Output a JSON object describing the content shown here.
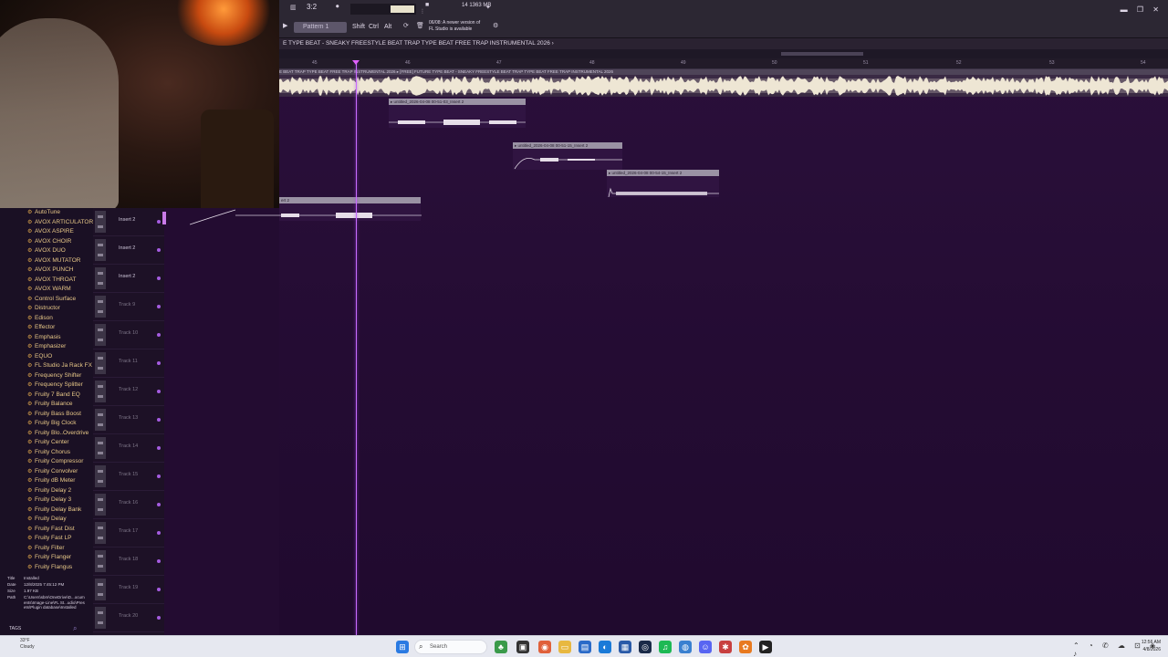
{
  "toolbar": {
    "tempo": "3:2",
    "cpu": "14   1363 MB",
    "pattern_label": "Pattern 1",
    "modifiers": [
      "Shift",
      "Ctrl",
      "Alt"
    ],
    "news_line1": "06/08: A newer version of",
    "news_line2": "FL Studio is available",
    "window_buttons": "▬ ❐ ✕"
  },
  "playlist": {
    "title": "E TYPE BEAT - SNEAKY FREESTYLE BEAT  TRAP TYPE BEAT  FREE TRAP INSTRUMENTAL 2026 ›",
    "ruler": [
      "45",
      "46",
      "47",
      "48",
      "49",
      "50",
      "51",
      "52",
      "53",
      "54"
    ],
    "main_clip_label": "E BEAT  TRAP TYPE BEAT  FREE TRAP INSTRUMENTAL 2026   ▸ [FREE] FUTURE TYPE BEAT - SNEAKY FREESTYLE BEAT  TRAP TYPE BEAT  FREE TRAP INSTRUMENTAL 2026",
    "clips": [
      {
        "label": "▸ untitled_2026-04-08 00-51-03_Insert 2"
      },
      {
        "label": "▸ untitled_2026-04-08 00-51-15_Insert 2"
      },
      {
        "label": "▸ untitled_2026-04-08 00-54-15_Insert 2"
      },
      {
        "label": "ert 2"
      }
    ]
  },
  "tracks": [
    {
      "name": "Insert 2",
      "active": true
    },
    {
      "name": "Insert 2",
      "active": true
    },
    {
      "name": "Insert 2",
      "active": true
    },
    {
      "name": "Track 9",
      "active": false
    },
    {
      "name": "Track 10",
      "active": false
    },
    {
      "name": "Track 11",
      "active": false
    },
    {
      "name": "Track 12",
      "active": false
    },
    {
      "name": "Track 13",
      "active": false
    },
    {
      "name": "Track 14",
      "active": false
    },
    {
      "name": "Track 15",
      "active": false
    },
    {
      "name": "Track 16",
      "active": false
    },
    {
      "name": "Track 17",
      "active": false
    },
    {
      "name": "Track 18",
      "active": false
    },
    {
      "name": "Track 19",
      "active": false
    },
    {
      "name": "Track 20",
      "active": false
    }
  ],
  "browser": {
    "plugins": [
      "AutoTune",
      "AVOX ARTICULATOR",
      "AVOX ASPIRE",
      "AVOX CHOIR",
      "AVOX DUO",
      "AVOX MUTATOR",
      "AVOX PUNCH",
      "AVOX THROAT",
      "AVOX WARM",
      "Control Surface",
      "Distructor",
      "Edison",
      "Effector",
      "Emphasis",
      "Emphasizer",
      "EQUO",
      "FL Studio Ja Rack FX",
      "Frequency Shifter",
      "Frequency Splitter",
      "Fruity 7 Band EQ",
      "Fruity Balance",
      "Fruity Bass Boost",
      "Fruity Big Clock",
      "Fruity Blo..Overdrive",
      "Fruity Center",
      "Fruity Chorus",
      "Fruity Compressor",
      "Fruity Convolver",
      "Fruity dB Meter",
      "Fruity Delay 2",
      "Fruity Delay 3",
      "Fruity Delay Bank",
      "Fruity Delay",
      "Fruity Fast Dist",
      "Fruity Fast LP",
      "Fruity Filter",
      "Fruity Flanger",
      "Fruity Flangus"
    ],
    "info": {
      "title_label": "Title",
      "title_value": "Installed",
      "date_label": "Date",
      "date_value": "12/8/2025 7:45:12 PM",
      "size_label": "Size",
      "size_value": "1.97 KB",
      "path_label": "Path",
      "path_value": "C:\\Users\\sbm\\OneDrive\\D...ocuments\\Image-Line\\FL St...udio\\Presets\\Plugin database\\Installed",
      "tags": "TAGS"
    }
  },
  "taskbar": {
    "weather_temp": "33°F",
    "weather_desc": "Cloudy",
    "search_placeholder": "Search",
    "time": "12:56 AM",
    "date": "4/8/2026"
  }
}
